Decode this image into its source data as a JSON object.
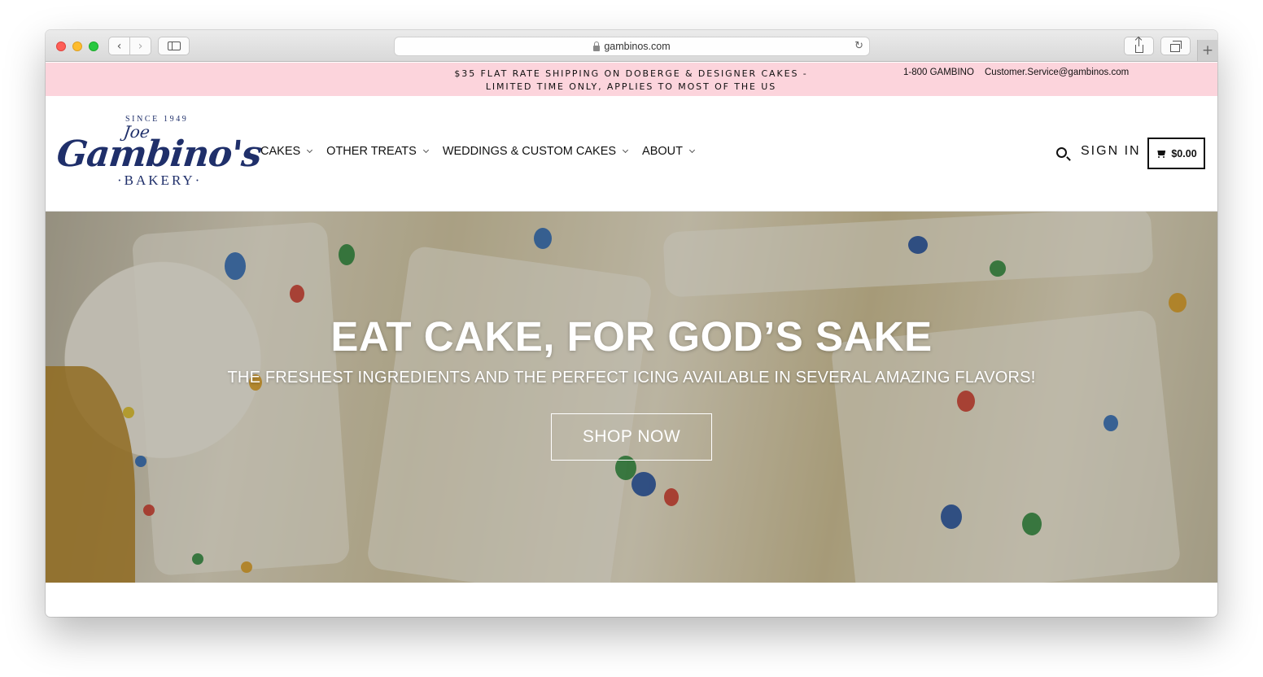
{
  "browser": {
    "url": "gambinos.com",
    "nav_back_icon": "chevron-left-icon",
    "nav_forward_icon": "chevron-right-icon",
    "reload_icon": "reload-icon"
  },
  "announcement": {
    "shipping_text": "$35 FLAT RATE SHIPPING ON DOBERGE & DESIGNER CAKES - LIMITED TIME ONLY, APPLIES TO MOST OF THE US",
    "phone": "1-800 GAMBINO",
    "email": "Customer.Service@gambinos.com",
    "background": "#fcd4dc"
  },
  "logo": {
    "since": "SINCE 1949",
    "first_name": "Joe",
    "name": "Gambino's",
    "bakery": "·BAKERY·",
    "color": "#1f2f6a"
  },
  "nav": {
    "items": [
      {
        "label": "CAKES"
      },
      {
        "label": "OTHER TREATS"
      },
      {
        "label": "WEDDINGS & CUSTOM CAKES"
      },
      {
        "label": "ABOUT"
      }
    ],
    "sign_in": "SIGN IN",
    "cart_total": "$0.00"
  },
  "hero": {
    "title": "EAT CAKE, FOR GOD’S SAKE",
    "subtitle": "THE FRESHEST INGREDIENTS AND THE PERFECT ICING AVAILABLE IN SEVERAL AMAZING FLAVORS!",
    "cta": "SHOP NOW"
  }
}
